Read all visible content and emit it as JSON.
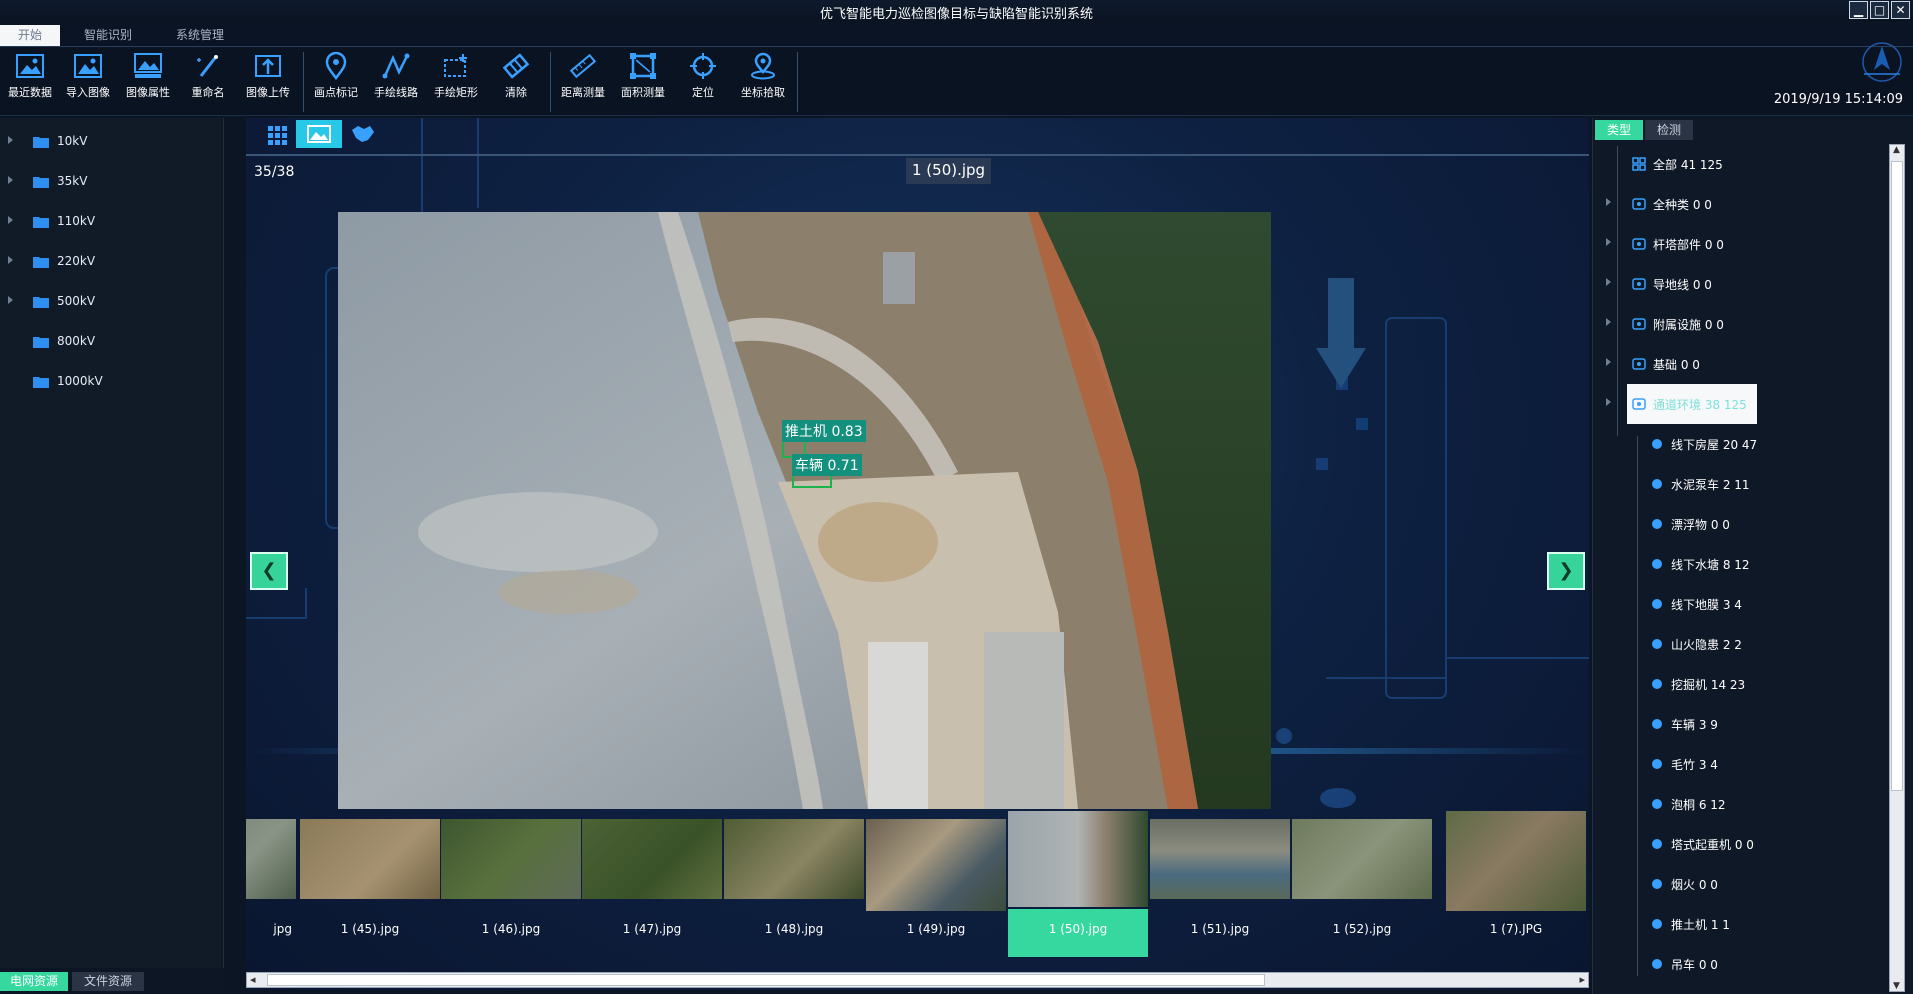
{
  "window": {
    "title": "优飞智能电力巡检图像目标与缺陷智能识别系统",
    "min_label": "▁",
    "max_label": "□",
    "close_label": "✕"
  },
  "menu": {
    "tabs": [
      {
        "label": "开始",
        "active": true
      },
      {
        "label": "智能识别",
        "active": false
      },
      {
        "label": "系统管理",
        "active": false
      }
    ]
  },
  "toolbar": {
    "items": [
      {
        "label": "最近数据",
        "icon": "recent-data-icon"
      },
      {
        "label": "导入图像",
        "icon": "import-image-icon"
      },
      {
        "label": "图像属性",
        "icon": "image-properties-icon"
      },
      {
        "label": "重命名",
        "icon": "rename-icon"
      },
      {
        "label": "图像上传",
        "icon": "upload-icon"
      },
      {
        "label": "画点标记",
        "icon": "point-marker-icon"
      },
      {
        "label": "手绘线路",
        "icon": "draw-line-icon"
      },
      {
        "label": "手绘矩形",
        "icon": "draw-rect-icon"
      },
      {
        "label": "清除",
        "icon": "eraser-icon"
      },
      {
        "label": "距离测量",
        "icon": "ruler-icon"
      },
      {
        "label": "面积测量",
        "icon": "area-measure-icon"
      },
      {
        "label": "定位",
        "icon": "locate-icon"
      },
      {
        "label": "坐标拾取",
        "icon": "coordinate-pick-icon"
      }
    ],
    "datetime": "2019/9/19 15:14:09"
  },
  "left_tree": {
    "items": [
      "10kV",
      "35kV",
      "110kV",
      "220kV",
      "500kV",
      "800kV",
      "1000kV"
    ],
    "bottom_tabs": [
      {
        "label": "电网资源",
        "active": true
      },
      {
        "label": "文件资源",
        "active": false
      }
    ]
  },
  "viewer": {
    "counter": "35/38",
    "filename": "1 (50).jpg",
    "detections": [
      {
        "label": "推土机 0.83"
      },
      {
        "label": "车辆 0.71"
      }
    ],
    "collapse_label": "×",
    "prev_label": "❮",
    "next_label": "❯",
    "thumbnails": [
      {
        "name": "jpg",
        "selected": false
      },
      {
        "name": "1 (45).jpg",
        "selected": false
      },
      {
        "name": "1 (46).jpg",
        "selected": false
      },
      {
        "name": "1 (47).jpg",
        "selected": false
      },
      {
        "name": "1 (48).jpg",
        "selected": false
      },
      {
        "name": "1 (49).jpg",
        "selected": false
      },
      {
        "name": "1 (50).jpg",
        "selected": true
      },
      {
        "name": "1 (51).jpg",
        "selected": false
      },
      {
        "name": "1 (52).jpg",
        "selected": false
      },
      {
        "name": "1 (7).JPG",
        "selected": false
      }
    ],
    "scroll_left": "◂",
    "scroll_right": "▸"
  },
  "right_panel": {
    "tabs": [
      {
        "label": "类型",
        "active": true
      },
      {
        "label": "检测",
        "active": false
      }
    ],
    "categories": [
      {
        "label": "全部 41 125",
        "icon": "grid-icon",
        "level": 0,
        "expandable": false
      },
      {
        "label": "全种类 0 0",
        "icon": "list-icon",
        "level": 0,
        "expandable": true
      },
      {
        "label": "杆塔部件 0 0",
        "icon": "tower-part-icon",
        "level": 0,
        "expandable": true
      },
      {
        "label": "导地线 0 0",
        "icon": "wire-icon",
        "level": 0,
        "expandable": true
      },
      {
        "label": "附属设施 0 0",
        "icon": "facility-icon",
        "level": 0,
        "expandable": true
      },
      {
        "label": "基础 0 0",
        "icon": "foundation-icon",
        "level": 0,
        "expandable": true
      },
      {
        "label": "通道环境 38 125",
        "icon": "channel-env-icon",
        "level": 0,
        "expandable": true,
        "selected": true
      },
      {
        "label": "线下房屋 20 47",
        "icon": "house-icon",
        "level": 1
      },
      {
        "label": "水泥泵车 2 11",
        "icon": "pump-truck-icon",
        "level": 1
      },
      {
        "label": "漂浮物 0 0",
        "icon": "float-icon",
        "level": 1
      },
      {
        "label": "线下水塘 8 12",
        "icon": "pond-icon",
        "level": 1
      },
      {
        "label": "线下地膜 3 4",
        "icon": "film-icon",
        "level": 1
      },
      {
        "label": "山火隐患 2 2",
        "icon": "fire-icon",
        "level": 1
      },
      {
        "label": "挖掘机 14 23",
        "icon": "excavator-icon",
        "level": 1
      },
      {
        "label": "车辆 3 9",
        "icon": "car-icon",
        "level": 1
      },
      {
        "label": "毛竹 3 4",
        "icon": "bamboo-icon",
        "level": 1
      },
      {
        "label": "泡桐 6 12",
        "icon": "tree-icon",
        "level": 1
      },
      {
        "label": "塔式起重机 0 0",
        "icon": "crane-icon",
        "level": 1
      },
      {
        "label": "烟火 0 0",
        "icon": "smoke-icon",
        "level": 1
      },
      {
        "label": "推土机 1 1",
        "icon": "bulldozer-icon",
        "level": 1
      },
      {
        "label": "吊车 0 0",
        "icon": "truck-crane-icon",
        "level": 1
      }
    ]
  },
  "colors": {
    "accent": "#36d8a0",
    "detection_box": "#1bb34c",
    "detection_label": "#14907e",
    "icon_blue": "#3aa0ff"
  }
}
